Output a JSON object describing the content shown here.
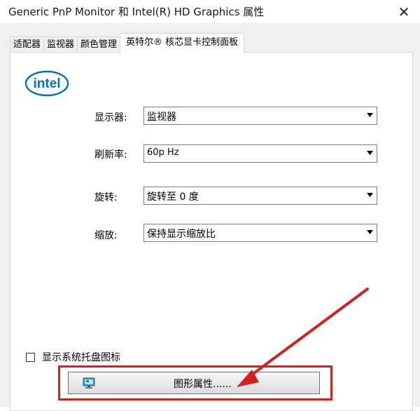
{
  "window": {
    "title": "Generic PnP Monitor 和 Intel(R) HD Graphics 属性",
    "close_glyph": "✕"
  },
  "tabs": [
    {
      "label": "适配器",
      "active": false
    },
    {
      "label": "监视器",
      "active": false
    },
    {
      "label": "颜色管理",
      "active": false
    },
    {
      "label": "英特尔® 核芯显卡控制面板",
      "active": true
    }
  ],
  "logo": {
    "text": "intel",
    "icon": "intel-logo"
  },
  "settings": {
    "display": {
      "label": "显示器:",
      "value": "监视器"
    },
    "refresh": {
      "label": "刷新率:",
      "value": "60p Hz"
    },
    "rotation": {
      "label": "旋转:",
      "value": "旋转至 0 度"
    },
    "scaling": {
      "label": "缩放:",
      "value": "保持显示缩放比"
    }
  },
  "tray_checkbox": {
    "label": "显示系统托盘图标",
    "checked": false
  },
  "graphics_button": {
    "label": "图形属性......",
    "icon": "graphics-properties-icon"
  },
  "colors": {
    "annotation_red": "#d62020",
    "intel_blue": "#0071c5"
  }
}
